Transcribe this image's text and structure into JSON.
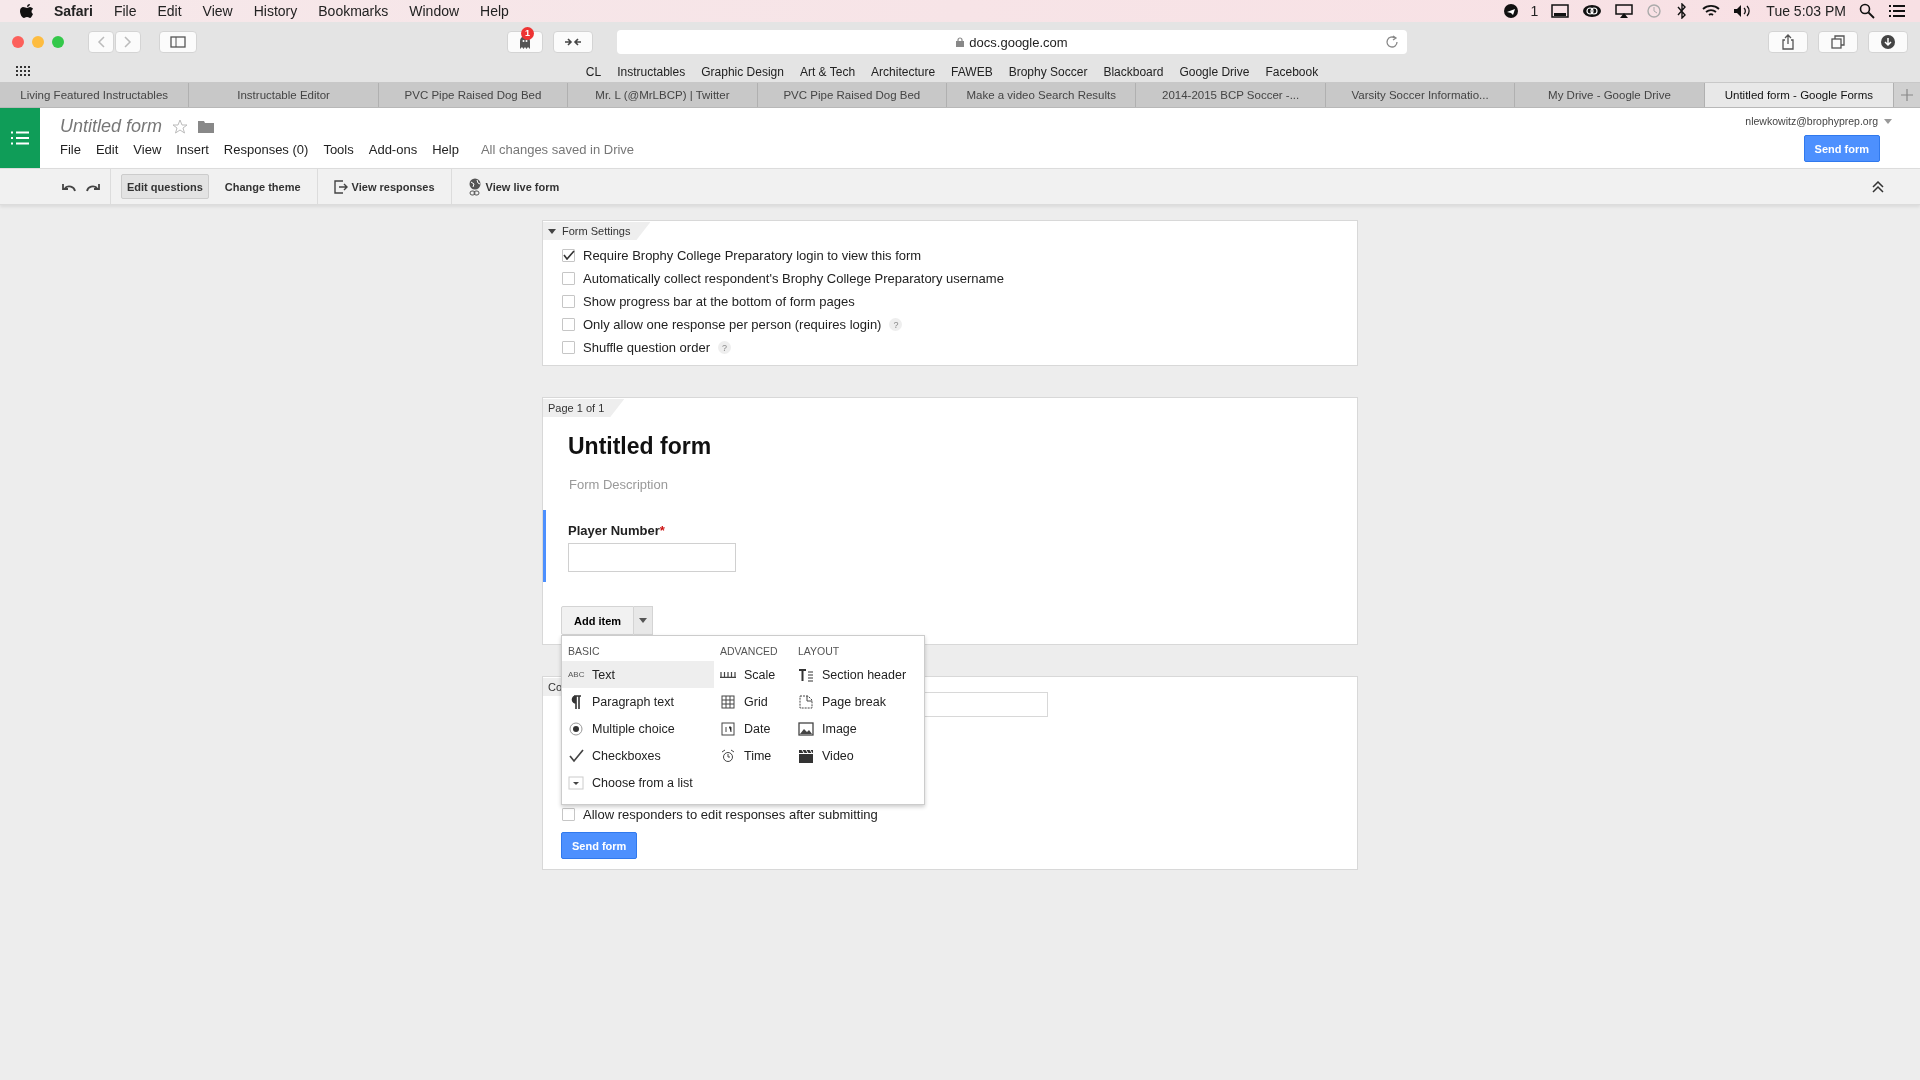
{
  "menubar": {
    "app": "Safari",
    "items": [
      "File",
      "Edit",
      "View",
      "History",
      "Bookmarks",
      "Window",
      "Help"
    ],
    "notification_count": "1",
    "clock": "Tue 5:03 PM"
  },
  "browser": {
    "extension_badge": "1",
    "address": "docs.google.com",
    "bookmarks": [
      "CL",
      "Instructables",
      "Graphic Design",
      "Art & Tech",
      "Architecture",
      "FAWEB",
      "Brophy Soccer",
      "Blackboard",
      "Google Drive",
      "Facebook"
    ],
    "tabs": [
      {
        "label": "Living Featured Instructables",
        "selected": false
      },
      {
        "label": "Instructable Editor",
        "selected": false
      },
      {
        "label": "PVC Pipe Raised Dog Bed",
        "selected": false
      },
      {
        "label": "Mr. L (@MrLBCP) | Twitter",
        "selected": false
      },
      {
        "label": "PVC Pipe Raised Dog Bed",
        "selected": false
      },
      {
        "label": "Make a video Search Results",
        "selected": false
      },
      {
        "label": "2014-2015 BCP Soccer -...",
        "selected": false
      },
      {
        "label": "Varsity Soccer Informatio...",
        "selected": false
      },
      {
        "label": "My Drive - Google Drive",
        "selected": false
      },
      {
        "label": "Untitled form - Google Forms",
        "selected": true
      }
    ]
  },
  "app": {
    "title": "Untitled form",
    "menu": [
      "File",
      "Edit",
      "View",
      "Insert",
      "Responses (0)",
      "Tools",
      "Add-ons",
      "Help"
    ],
    "save_status": "All changes saved in Drive",
    "account": "nlewkowitz@brophyprep.org",
    "send_button": "Send form"
  },
  "toolbar": {
    "buttons": [
      {
        "label": "Edit questions",
        "kind": "plain",
        "selected": true
      },
      {
        "label": "Change theme",
        "kind": "plain",
        "selected": false
      },
      {
        "label": "View responses",
        "kind": "responses",
        "selected": false
      },
      {
        "label": "View live form",
        "kind": "live",
        "selected": false
      }
    ]
  },
  "form_settings": {
    "heading": "Form Settings",
    "expanded": true,
    "options": [
      {
        "label": "Require Brophy College Preparatory login to view this form",
        "checked": true
      },
      {
        "label": "Automatically collect respondent's Brophy College Preparatory username",
        "checked": false
      },
      {
        "label": "Show progress bar at the bottom of form pages",
        "checked": false
      },
      {
        "label": "Only allow one response per person (requires login)",
        "checked": false,
        "help": "?"
      },
      {
        "label": "Shuffle question order",
        "checked": false,
        "help": "?"
      }
    ]
  },
  "page": {
    "label": "Page 1 of 1",
    "title": "Untitled form",
    "description_placeholder": "Form Description",
    "question": {
      "label": "Player Number",
      "required_mark": "*"
    },
    "add_item": "Add item"
  },
  "add_menu": {
    "columns": [
      {
        "heading": "BASIC",
        "items": [
          {
            "label": "Text",
            "kind": "abc",
            "icon_text": "ABC",
            "selected": true
          },
          {
            "label": "Paragraph text",
            "kind": "pilcrow",
            "selected": false
          },
          {
            "label": "Multiple choice",
            "kind": "radio",
            "selected": false
          },
          {
            "label": "Checkboxes",
            "kind": "check",
            "selected": false
          },
          {
            "label": "Choose from a list",
            "kind": "dropdown",
            "selected": false
          }
        ]
      },
      {
        "heading": "ADVANCED",
        "items": [
          {
            "label": "Scale",
            "kind": "scale",
            "selected": false
          },
          {
            "label": "Grid",
            "kind": "grid",
            "selected": false
          },
          {
            "label": "Date",
            "kind": "date",
            "selected": false
          },
          {
            "label": "Time",
            "kind": "time",
            "selected": false
          }
        ]
      },
      {
        "heading": "LAYOUT",
        "items": [
          {
            "label": "Section header",
            "kind": "section",
            "selected": false
          },
          {
            "label": "Page break",
            "kind": "pagebreak",
            "selected": false
          },
          {
            "label": "Image",
            "kind": "image",
            "selected": false
          },
          {
            "label": "Video",
            "kind": "video",
            "selected": false
          }
        ]
      }
    ]
  },
  "confirmation": {
    "label": "Co",
    "option": {
      "label": "Allow responders to edit responses after submitting",
      "checked": false
    },
    "send_button": "Send form"
  }
}
